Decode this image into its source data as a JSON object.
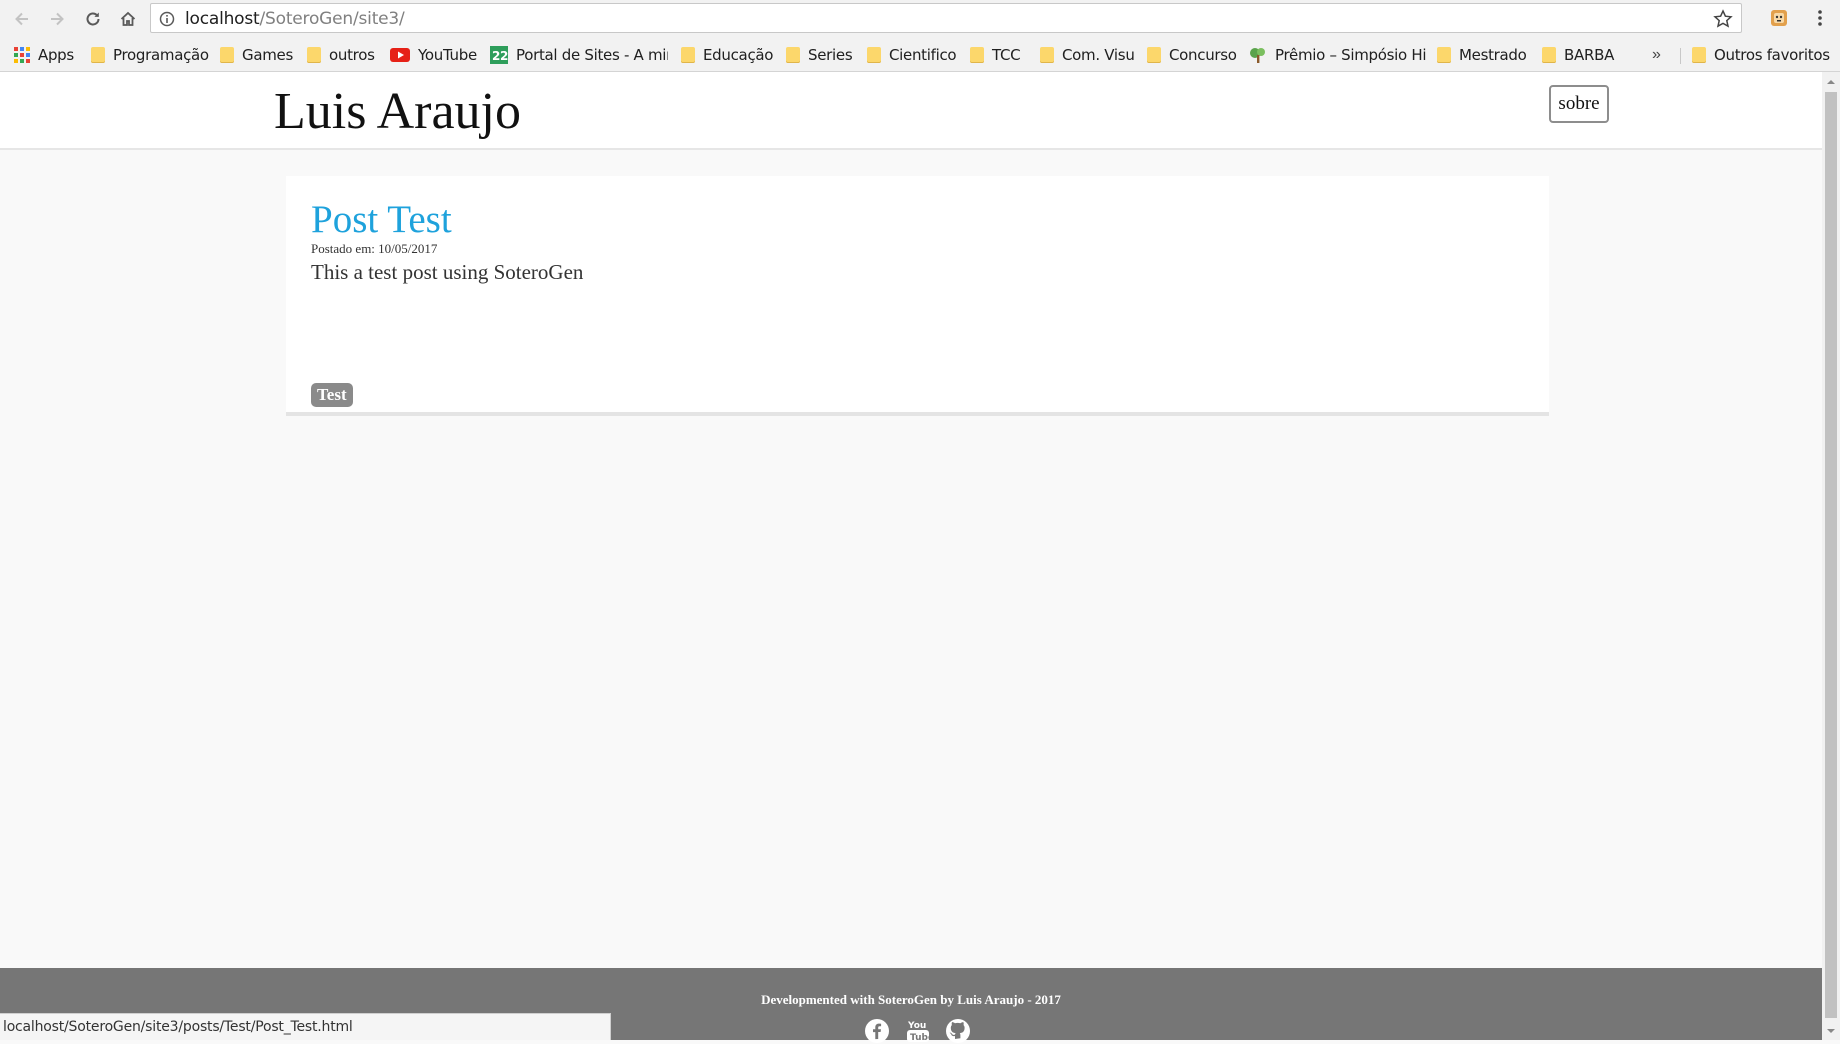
{
  "browser": {
    "url_host": "localhost",
    "url_path": "/SoteroGen/site3/",
    "status_url": "localhost/SoteroGen/site3/posts/Test/Post_Test.html"
  },
  "bookmarks": [
    {
      "label": "Apps",
      "icon": "apps-grid-icon"
    },
    {
      "label": "Programação",
      "icon": "folder-icon"
    },
    {
      "label": "Games",
      "icon": "folder-icon"
    },
    {
      "label": "outros",
      "icon": "folder-icon"
    },
    {
      "label": "YouTube",
      "icon": "youtube-icon"
    },
    {
      "label": "Portal de Sites - A mir",
      "icon": "portal-icon"
    },
    {
      "label": "Educação",
      "icon": "folder-icon"
    },
    {
      "label": "Series",
      "icon": "folder-icon"
    },
    {
      "label": "Cientifico",
      "icon": "folder-icon"
    },
    {
      "label": "TCC",
      "icon": "folder-icon"
    },
    {
      "label": "Com. Visu",
      "icon": "folder-icon"
    },
    {
      "label": "Concurso",
      "icon": "folder-icon"
    },
    {
      "label": "Prêmio – Simpósio Hi",
      "icon": "tree-icon"
    },
    {
      "label": "Mestrado",
      "icon": "folder-icon"
    },
    {
      "label": "BARBA",
      "icon": "folder-icon"
    }
  ],
  "bookmarks_more": "»",
  "other_bookmarks": "Outros favoritos",
  "site": {
    "title": "Luis Araujo",
    "about_label": "sobre"
  },
  "post": {
    "title": "Post Test",
    "date": "Postado em: 10/05/2017",
    "body": "This a test post using SoteroGen",
    "tag": "Test"
  },
  "footer": {
    "text": "Developmented with SoteroGen by Luis Araujo - 2017",
    "social": [
      "facebook-icon",
      "youtube-icon",
      "github-icon"
    ]
  },
  "colors": {
    "link_blue": "#1ea2dc",
    "footer_gray": "#767676",
    "tag_gray": "#8a8a8a"
  }
}
